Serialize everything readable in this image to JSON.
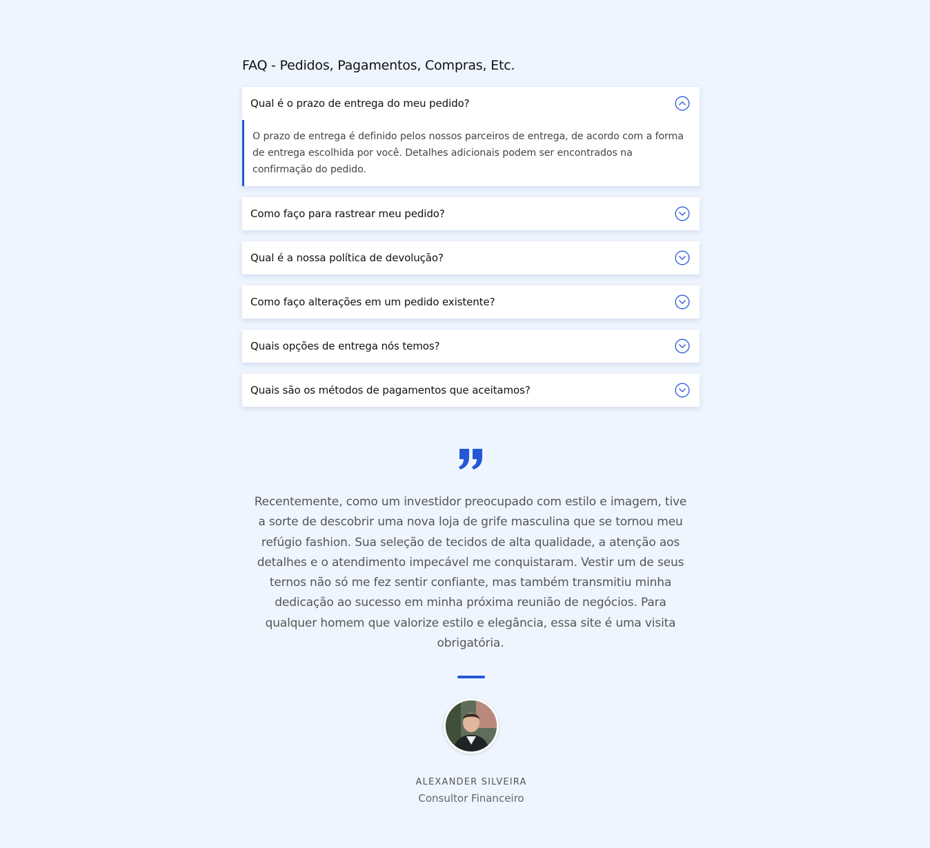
{
  "colors": {
    "background": "#eef5ff",
    "accent": "#2457d6",
    "card": "#ffffff"
  },
  "faq": {
    "title": "FAQ - Pedidos, Pagamentos, Compras, Etc.",
    "items": [
      {
        "question": "Qual é o prazo de entrega do meu pedido?",
        "answer": "O prazo de entrega é definido pelos nossos parceiros de entrega, de acordo com a forma de entrega escolhida por você. Detalhes adicionais podem ser encontrados na confirmação do pedido.",
        "expanded": true,
        "icon": "chevron-up-icon"
      },
      {
        "question": "Como faço para rastrear meu pedido?",
        "expanded": false,
        "icon": "chevron-down-icon"
      },
      {
        "question": "Qual é a nossa política de devolução?",
        "expanded": false,
        "icon": "chevron-down-icon"
      },
      {
        "question": "Como faço alterações em um pedido existente?",
        "expanded": false,
        "icon": "chevron-down-icon"
      },
      {
        "question": "Quais opções de entrega nós temos?",
        "expanded": false,
        "icon": "chevron-down-icon"
      },
      {
        "question": "Quais são os métodos de pagamentos que aceitamos?",
        "expanded": false,
        "icon": "chevron-down-icon"
      }
    ]
  },
  "testimonial": {
    "icon": "quote-icon",
    "text": "Recentemente, como um investidor preocupado com estilo e imagem, tive a sorte de descobrir uma nova loja de grife masculina que se tornou meu refúgio fashion. Sua seleção de tecidos de alta qualidade, a atenção aos detalhes e o atendimento impecável me conquistaram. Vestir um de seus ternos não só me fez sentir confiante, mas também transmitiu minha dedicação ao sucesso em minha próxima reunião de negócios. Para qualquer homem que valorize estilo e elegância, essa site é uma visita obrigatória.",
    "author_name": "ALEXANDER SILVEIRA",
    "author_role": "Consultor Financeiro"
  }
}
